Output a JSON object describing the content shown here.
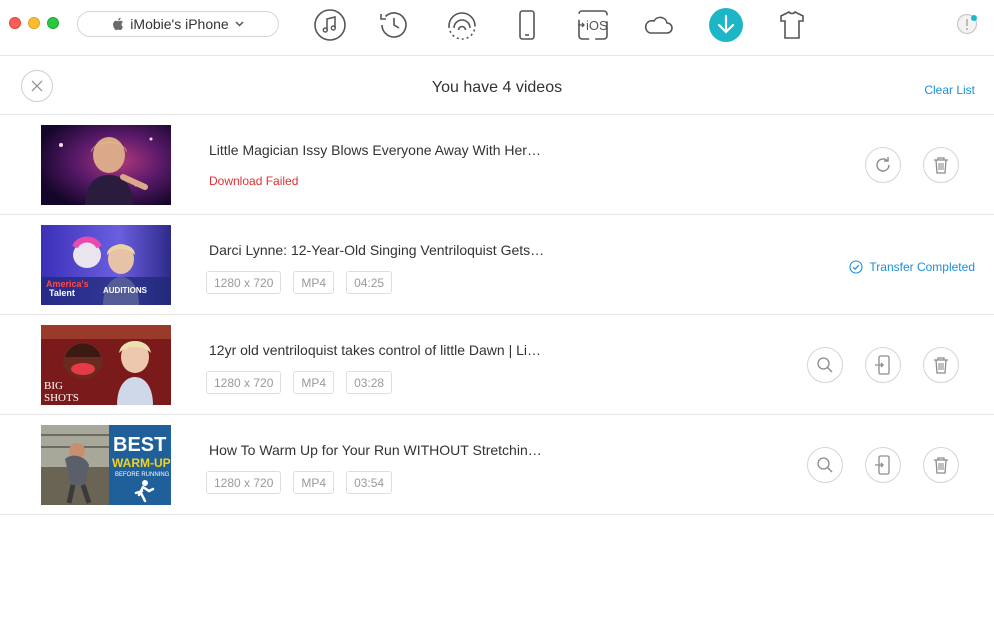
{
  "device": {
    "name": "iMobie's iPhone"
  },
  "toolbar": {
    "icons": [
      "music-icon",
      "history-icon",
      "wifi-icon",
      "phone-icon",
      "ios-transfer-icon",
      "cloud-icon",
      "download-icon",
      "shirt-icon"
    ],
    "ios_label": "iOS"
  },
  "list": {
    "title": "You have 4 videos",
    "clear_label": "Clear List"
  },
  "videos": [
    {
      "title": "Little Magician Issy Blows Everyone Away With Her…",
      "status": "Download Failed"
    },
    {
      "title": "Darci Lynne: 12-Year-Old Singing Ventriloquist Gets…",
      "resolution": "1280 x 720",
      "format": "MP4",
      "duration": "04:25",
      "status": "Transfer Completed",
      "thumb_text": [
        "America's",
        "Talent",
        "AUDITIONS"
      ]
    },
    {
      "title": "12yr old ventriloquist takes control of little Dawn | Li…",
      "resolution": "1280 x 720",
      "format": "MP4",
      "duration": "03:28",
      "thumb_text": [
        "BIG",
        "SHOTS"
      ]
    },
    {
      "title": "How To Warm Up for Your Run WITHOUT Stretchin…",
      "resolution": "1280 x 720",
      "format": "MP4",
      "duration": "03:54",
      "thumb_text": [
        "BEST",
        "WARM-UP",
        "BEFORE RUNNING"
      ]
    }
  ],
  "colors": {
    "accent": "#1cb6c6",
    "link": "#1b8fd8",
    "error": "#e0312e",
    "border": "#e6e6e6"
  }
}
